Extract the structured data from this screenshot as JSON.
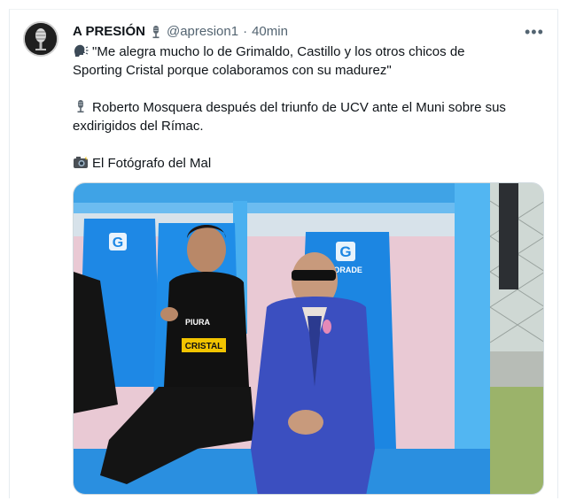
{
  "tweet": {
    "author_name": "A PRESIÓN",
    "handle": "@apresion1",
    "separator": "·",
    "time": "40min",
    "more_label": "•••",
    "line1": "\"Me alegra mucho lo de Grimaldo, Castillo y los otros chicos de",
    "line2": "Sporting Cristal porque colaboramos con su madurez\"",
    "line3": "Roberto Mosquera después del triunfo de UCV ante el Muni sobre sus",
    "line4": "exdirigidos del Rímac.",
    "line5": "El Fotógrafo del Mal"
  },
  "photo": {
    "left_seat_logo": "G",
    "right_seat_logo": "G",
    "right_seat_brand": "TORADE",
    "jacket_text": "CRISTAL",
    "jacket_sponsor": "PIURA"
  },
  "icons": {
    "avatar": "microphone-avatar-icon",
    "verified": "microphone-icon",
    "speaker": "speaking-head-icon",
    "mic": "microphone-icon",
    "camera": "camera-flash-icon",
    "more": "more-options-icon"
  },
  "colors": {
    "text": "#0f1419",
    "muted": "#536471",
    "seat_blue": "#1e88e5",
    "suit_blue": "#3b4fc0"
  }
}
